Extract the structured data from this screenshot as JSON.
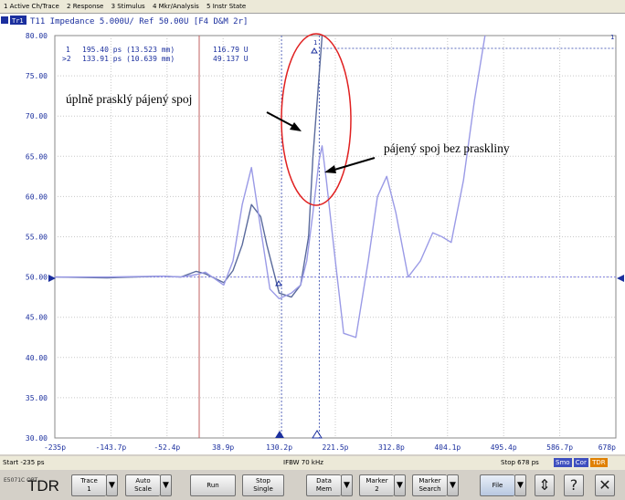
{
  "menu": [
    "1 Active Ch/Trace",
    "2 Response",
    "3 Stimulus",
    "4 Mkr/Analysis",
    "5 Instr State"
  ],
  "trace_header": {
    "badge": "Tr1",
    "text": "T11 Impedance 5.000U/ Ref 50.00U [F4 D&M 2r]"
  },
  "markers": [
    {
      "id": "1",
      "text": "195.40 ps (13.523 mm)",
      "value": "116.79 U"
    },
    {
      "id": ">2",
      "text": "133.91 ps (10.639 mm)",
      "value": "49.137 U"
    }
  ],
  "annotations": {
    "cracked": "úplně prasklý pájený spoj",
    "intact": "pájený spoj bez praskliny"
  },
  "chart_data": {
    "type": "line",
    "ylim": [
      30,
      80
    ],
    "xlim": [
      -235,
      678
    ],
    "y_ticks": [
      "80.00",
      "75.00",
      "70.00",
      "65.00",
      "60.00",
      "55.00",
      "50.00",
      "45.00",
      "40.00",
      "35.00",
      "30.00"
    ],
    "x_ticks": [
      "-235p",
      "-143.7p",
      "-52.4p",
      "38.9p",
      "130.2p",
      "221.5p",
      "312.8p",
      "404.1p",
      "495.4p",
      "586.7p",
      "678p"
    ],
    "reference_level": 50,
    "series": [
      {
        "color": "#5a6a9c",
        "x": [
          -235,
          -150,
          -60,
          -30,
          -5,
          10,
          40,
          55,
          70,
          85,
          100,
          110,
          130,
          150,
          165,
          178,
          185,
          192,
          198,
          205,
          215
        ],
        "y": [
          50,
          49.9,
          50.1,
          50,
          50.7,
          50.4,
          49.3,
          50.8,
          54,
          59,
          57.5,
          54,
          48,
          47.5,
          49,
          55,
          65,
          72,
          78,
          85,
          100
        ]
      },
      {
        "color": "#9a9ae6",
        "x": [
          -235,
          -150,
          -60,
          -30,
          -5,
          10,
          40,
          55,
          70,
          85,
          100,
          115,
          130,
          150,
          165,
          175,
          185,
          195,
          200,
          207,
          220,
          235,
          255,
          275,
          290,
          305,
          320,
          340,
          360,
          380,
          395,
          410,
          430,
          448,
          465
        ],
        "y": [
          50,
          50,
          50.1,
          50,
          50.3,
          50.6,
          49,
          52,
          59,
          63.6,
          56,
          48.5,
          47.3,
          48,
          49,
          52,
          58,
          64.5,
          66.3,
          62,
          53,
          43,
          42.5,
          52,
          60,
          62.5,
          58,
          50,
          52,
          55.5,
          55,
          54.3,
          62,
          72,
          80
        ]
      }
    ],
    "stimulus": {
      "start": "Start -235 ps",
      "ifbw": "IFBW 70 kHz",
      "stop": "Stop 678 ps"
    },
    "status_tags": [
      {
        "label": "Smo",
        "color": "#3e4fbf"
      },
      {
        "label": "Cor",
        "color": "#3e4fbf"
      },
      {
        "label": "TDR",
        "color": "#e08000"
      }
    ]
  },
  "softkeys": {
    "logo_small": "E5071C OPT.",
    "logo_big": "TDR",
    "trace": [
      "Trace",
      "1"
    ],
    "autoscale": [
      "Auto",
      "Scale"
    ],
    "run": "Run",
    "stop": [
      "Stop",
      "Single"
    ],
    "datamem": [
      "Data",
      "Mem"
    ],
    "marker": [
      "Marker",
      "2"
    ],
    "markersearch": [
      "Marker",
      "Search"
    ],
    "file": "File"
  },
  "colors": {
    "screen_bg": "#ffffff",
    "grid": "#c8c8c8",
    "text_blue": "#1b2f9e",
    "ellipse": "#e02020"
  }
}
